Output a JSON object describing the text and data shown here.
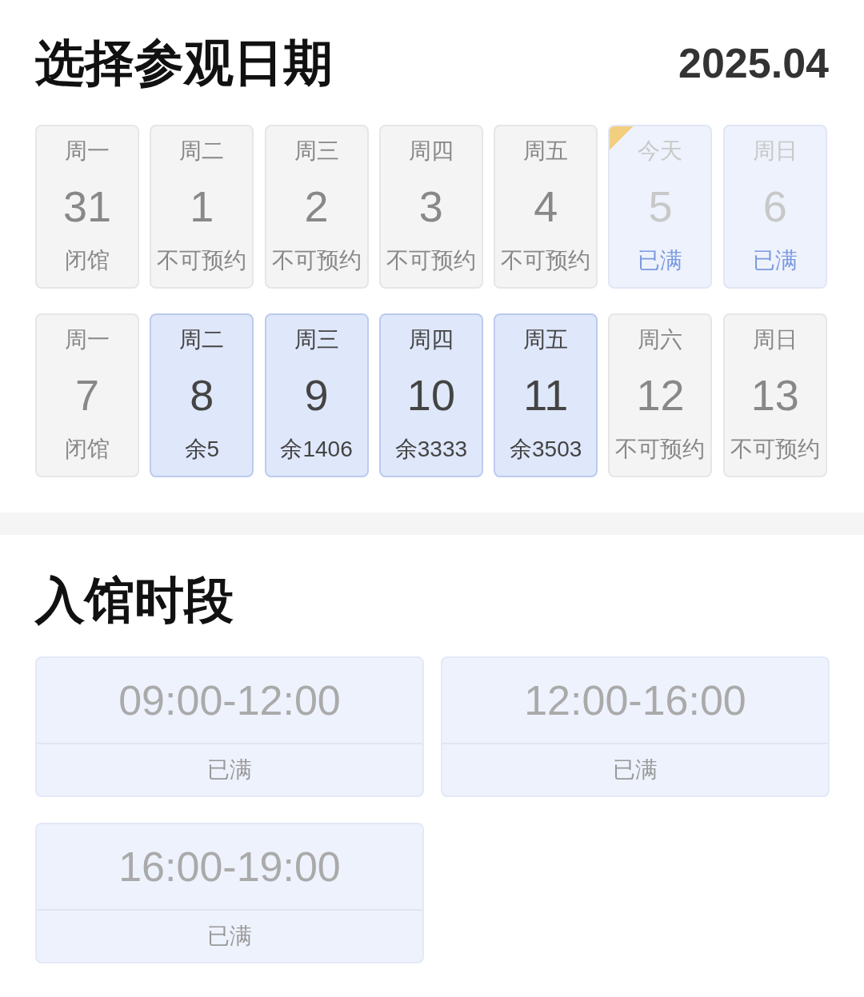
{
  "date_section": {
    "title": "选择参观日期",
    "month": "2025.04"
  },
  "days": [
    {
      "weekday": "周一",
      "date": "31",
      "status": "闭馆",
      "kind": "unavailable",
      "today": false
    },
    {
      "weekday": "周二",
      "date": "1",
      "status": "不可预约",
      "kind": "unavailable",
      "today": false
    },
    {
      "weekday": "周三",
      "date": "2",
      "status": "不可预约",
      "kind": "unavailable",
      "today": false
    },
    {
      "weekday": "周四",
      "date": "3",
      "status": "不可预约",
      "kind": "unavailable",
      "today": false
    },
    {
      "weekday": "周五",
      "date": "4",
      "status": "不可预约",
      "kind": "unavailable",
      "today": false
    },
    {
      "weekday": "今天",
      "date": "5",
      "status": "已满",
      "kind": "full",
      "today": true
    },
    {
      "weekday": "周日",
      "date": "6",
      "status": "已满",
      "kind": "full",
      "today": false
    },
    {
      "weekday": "周一",
      "date": "7",
      "status": "闭馆",
      "kind": "unavailable",
      "today": false
    },
    {
      "weekday": "周二",
      "date": "8",
      "status": "余5",
      "kind": "available",
      "today": false
    },
    {
      "weekday": "周三",
      "date": "9",
      "status": "余1406",
      "kind": "available",
      "today": false
    },
    {
      "weekday": "周四",
      "date": "10",
      "status": "余3333",
      "kind": "available",
      "today": false
    },
    {
      "weekday": "周五",
      "date": "11",
      "status": "余3503",
      "kind": "available",
      "today": false
    },
    {
      "weekday": "周六",
      "date": "12",
      "status": "不可预约",
      "kind": "unavailable",
      "today": false
    },
    {
      "weekday": "周日",
      "date": "13",
      "status": "不可预约",
      "kind": "unavailable",
      "today": false
    }
  ],
  "time_section": {
    "title": "入馆时段"
  },
  "slots": [
    {
      "time": "09:00-12:00",
      "status": "已满",
      "kind": "full"
    },
    {
      "time": "12:00-16:00",
      "status": "已满",
      "kind": "full"
    },
    {
      "time": "16:00-19:00",
      "status": "已满",
      "kind": "full"
    }
  ]
}
